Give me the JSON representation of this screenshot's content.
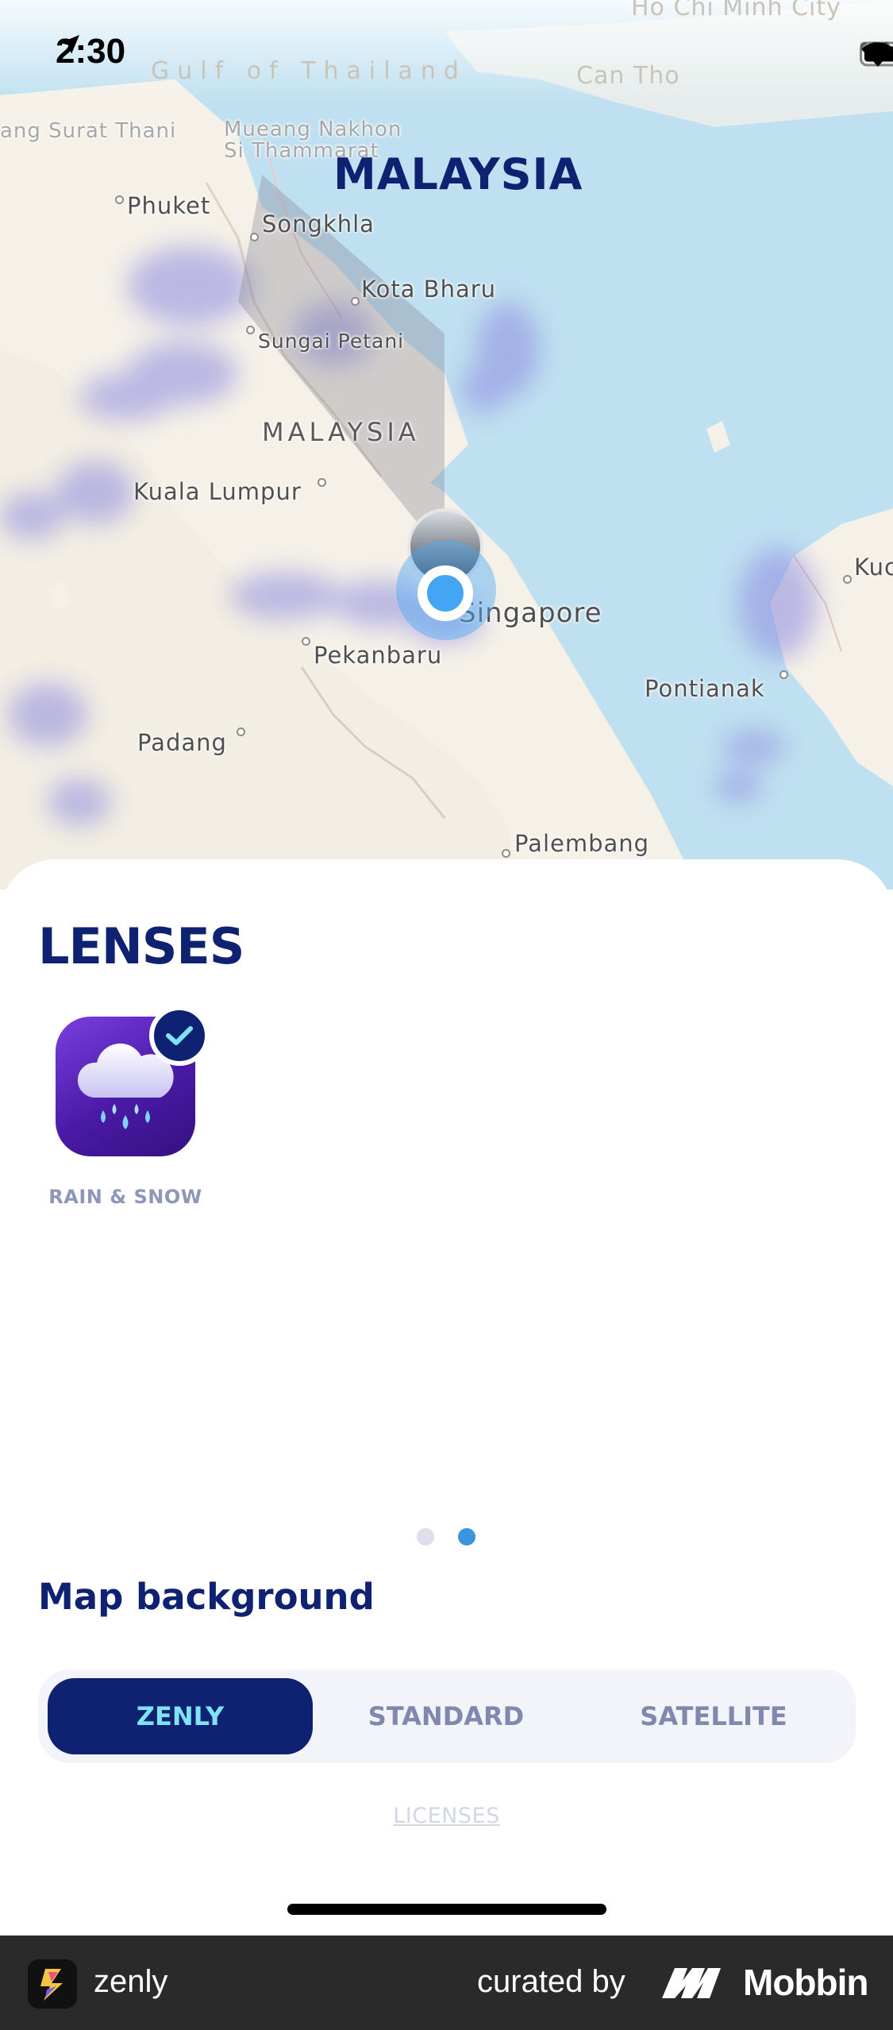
{
  "status_bar": {
    "time": "2:30"
  },
  "map": {
    "region_title": "MALAYSIA",
    "labels": {
      "ho_chi_minh": "Ho Chi Minh City",
      "gulf": "Gulf of Thailand",
      "can_tho": "Can Tho",
      "surat_thani": "ang Surat Thani",
      "nakhon": "Mueang Nakhon",
      "thammarat": "Si Thammarat",
      "phuket": "Phuket",
      "songkhla": "Songkhla",
      "kota_bharu": "Kota Bharu",
      "sungai_petani": "Sungai Petani",
      "malaysia": "MALAYSIA",
      "kuala_lumpur": "Kuala Lumpur",
      "singapore": "Singapore",
      "pekanbaru": "Pekanbaru",
      "pontianak": "Pontianak",
      "kuching": "Kuc",
      "padang": "Padang",
      "palembang": "Palembang"
    }
  },
  "sheet": {
    "title": "LENSES",
    "lenses": [
      {
        "label": "RAIN & SNOW",
        "selected": true,
        "icon": "rain-cloud-icon"
      }
    ],
    "pager": {
      "count": 2,
      "active_index": 1
    },
    "map_background": {
      "title": "Map background",
      "options": [
        "ZENLY",
        "STANDARD",
        "SATELLITE"
      ],
      "selected": "ZENLY"
    },
    "licenses_link": "LICENSES"
  },
  "footer": {
    "app_name": "zenly",
    "curated_by": "curated by",
    "brand": "Mobbin"
  },
  "colors": {
    "navy": "#0f2272",
    "accent_cyan": "#7fe3f5",
    "water": "#bfe0f0",
    "land": "#f5f1e8",
    "user_blue": "#45a5f5"
  }
}
